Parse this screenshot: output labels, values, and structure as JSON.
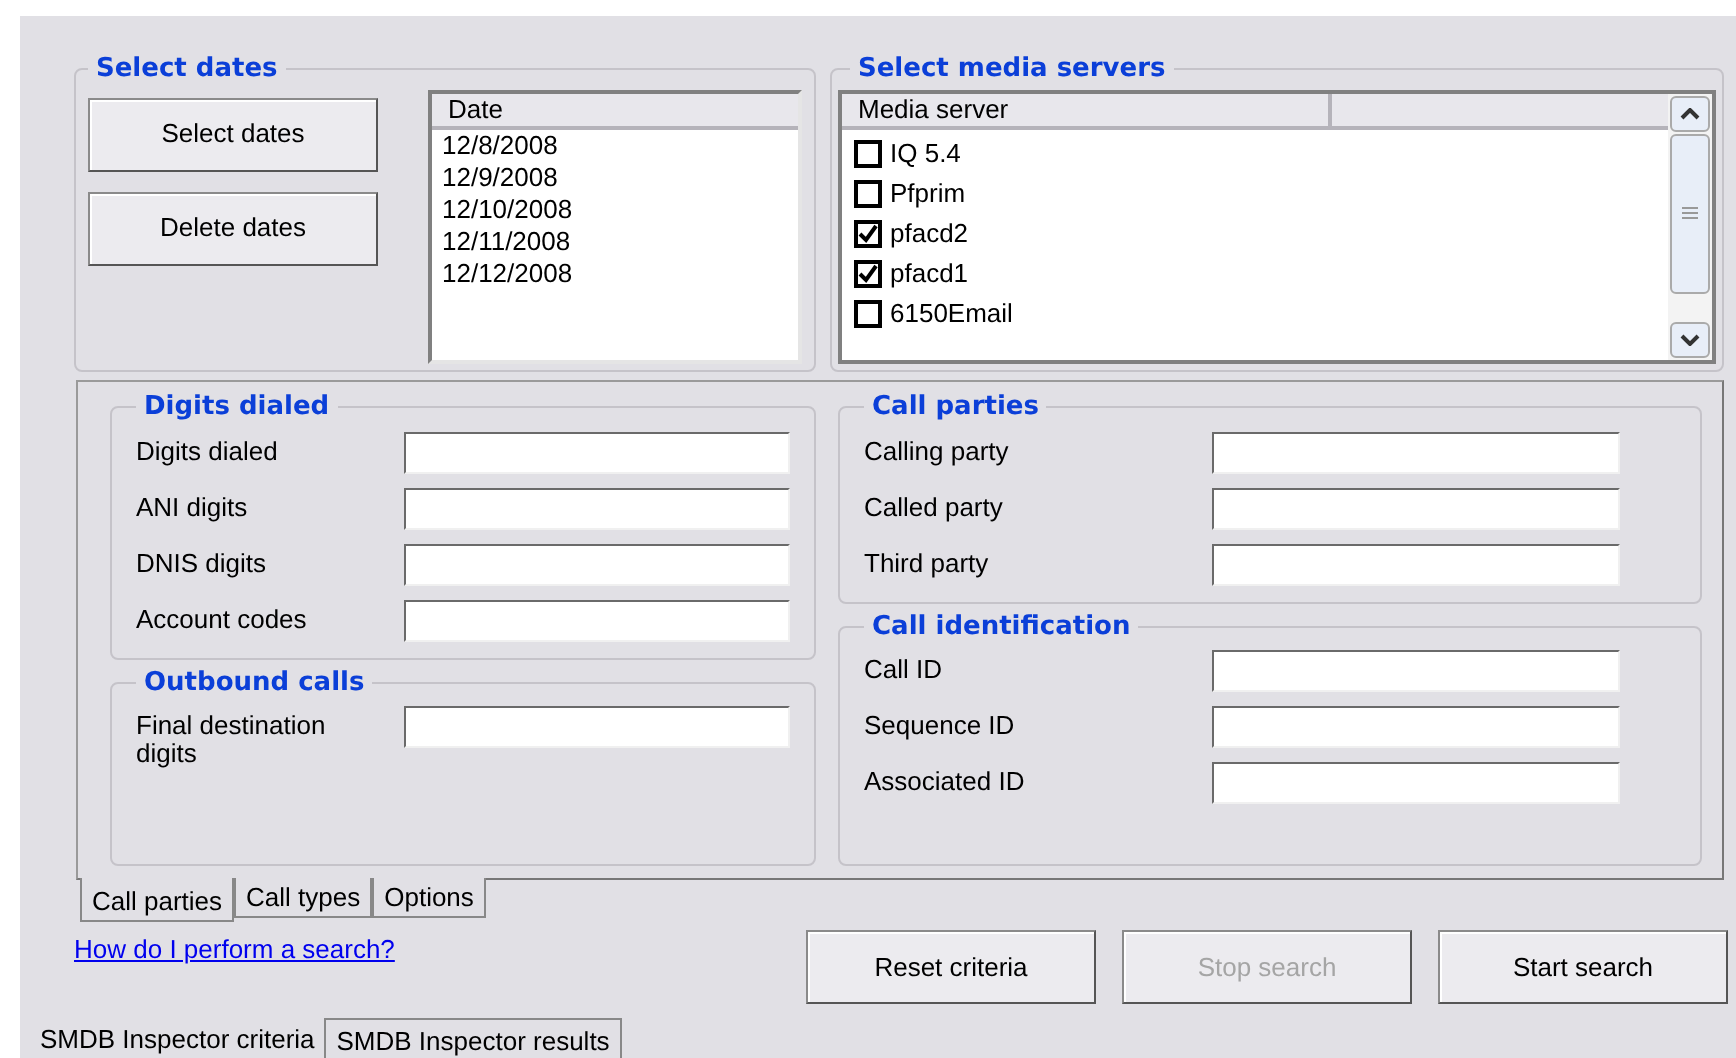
{
  "date_selection": {
    "title": "Select dates",
    "buttons": [
      "Select dates",
      "Delete dates"
    ],
    "column": "Date",
    "dates": [
      "12/8/2008",
      "12/9/2008",
      "12/10/2008",
      "12/11/2008",
      "12/12/2008"
    ]
  },
  "media_servers": {
    "title": "Select media servers",
    "column": "Media server",
    "servers": [
      {
        "name": "IQ 5.4",
        "checked": false
      },
      {
        "name": "Pfprim",
        "checked": false
      },
      {
        "name": "pfacd2",
        "checked": true
      },
      {
        "name": "pfacd1",
        "checked": true
      },
      {
        "name": "6150Email",
        "checked": false
      }
    ]
  },
  "left_groups": [
    {
      "title": "Digits dialed",
      "fields": [
        {
          "label": "Digits dialed"
        },
        {
          "label": "ANI digits"
        },
        {
          "label": "DNIS digits"
        },
        {
          "label": "Account codes"
        }
      ]
    },
    {
      "title": "Outbound calls",
      "fields": [
        {
          "label": "Final destination digits"
        }
      ]
    }
  ],
  "right_groups": [
    {
      "title": "Call parties",
      "fields": [
        {
          "label": "Calling party"
        },
        {
          "label": "Called party"
        },
        {
          "label": "Third party"
        }
      ]
    },
    {
      "title": "Call identification",
      "fields": [
        {
          "label": "Call ID"
        },
        {
          "label": "Sequence ID"
        },
        {
          "label": "Associated ID"
        }
      ]
    }
  ],
  "tabs": [
    {
      "label": "Call parties",
      "selected": true
    },
    {
      "label": "Call types",
      "selected": false
    },
    {
      "label": "Options",
      "selected": false
    }
  ],
  "help_link": "How do I perform a search?",
  "actions": [
    {
      "label": "Reset criteria",
      "disabled": false
    },
    {
      "label": "Stop search",
      "disabled": true
    },
    {
      "label": "Start search",
      "disabled": false
    }
  ],
  "bottom_tabs": [
    {
      "label": "SMDB Inspector criteria",
      "selected": true
    },
    {
      "label": "SMDB Inspector results",
      "selected": false
    }
  ]
}
